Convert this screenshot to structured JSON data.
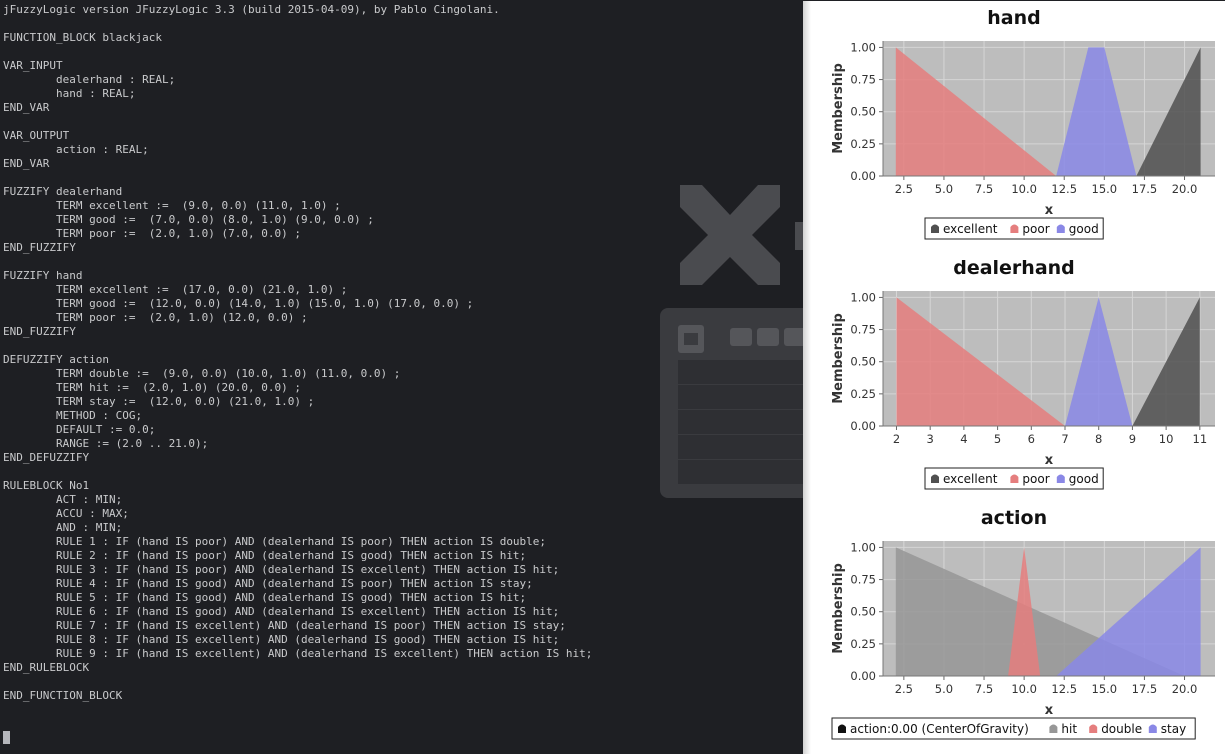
{
  "terminal": {
    "lines": [
      "jFuzzyLogic version JFuzzyLogic 3.3 (build 2015-04-09), by Pablo Cingolani.",
      "",
      "FUNCTION_BLOCK blackjack",
      "",
      "VAR_INPUT",
      "\tdealerhand : REAL;",
      "\thand : REAL;",
      "END_VAR",
      "",
      "VAR_OUTPUT",
      "\taction : REAL;",
      "END_VAR",
      "",
      "FUZZIFY dealerhand",
      "\tTERM excellent :=  (9.0, 0.0) (11.0, 1.0) ;",
      "\tTERM good :=  (7.0, 0.0) (8.0, 1.0) (9.0, 0.0) ;",
      "\tTERM poor :=  (2.0, 1.0) (7.0, 0.0) ;",
      "END_FUZZIFY",
      "",
      "FUZZIFY hand",
      "\tTERM excellent :=  (17.0, 0.0) (21.0, 1.0) ;",
      "\tTERM good :=  (12.0, 0.0) (14.0, 1.0) (15.0, 1.0) (17.0, 0.0) ;",
      "\tTERM poor :=  (2.0, 1.0) (12.0, 0.0) ;",
      "END_FUZZIFY",
      "",
      "DEFUZZIFY action",
      "\tTERM double :=  (9.0, 0.0) (10.0, 1.0) (11.0, 0.0) ;",
      "\tTERM hit :=  (2.0, 1.0) (20.0, 0.0) ;",
      "\tTERM stay :=  (12.0, 0.0) (21.0, 1.0) ;",
      "\tMETHOD : COG;",
      "\tDEFAULT := 0.0;",
      "\tRANGE := (2.0 .. 21.0);",
      "END_DEFUZZIFY",
      "",
      "RULEBLOCK No1",
      "\tACT : MIN;",
      "\tACCU : MAX;",
      "\tAND : MIN;",
      "\tRULE 1 : IF (hand IS poor) AND (dealerhand IS poor) THEN action IS double;",
      "\tRULE 2 : IF (hand IS poor) AND (dealerhand IS good) THEN action IS hit;",
      "\tRULE 3 : IF (hand IS poor) AND (dealerhand IS excellent) THEN action IS hit;",
      "\tRULE 4 : IF (hand IS good) AND (dealerhand IS poor) THEN action IS stay;",
      "\tRULE 5 : IF (hand IS good) AND (dealerhand IS good) THEN action IS hit;",
      "\tRULE 6 : IF (hand IS good) AND (dealerhand IS excellent) THEN action IS hit;",
      "\tRULE 7 : IF (hand IS excellent) AND (dealerhand IS poor) THEN action IS stay;",
      "\tRULE 8 : IF (hand IS excellent) AND (dealerhand IS good) THEN action IS hit;",
      "\tRULE 9 : IF (hand IS excellent) AND (dealerhand IS excellent) THEN action IS hit;",
      "END_RULEBLOCK",
      "",
      "END_FUNCTION_BLOCK"
    ],
    "bg_color": "#1e1f23",
    "text_color": "#c9cacc"
  },
  "wallpaper": {
    "logo_icon": "x-keyboard-logo-icon"
  },
  "colors": {
    "plot_bg": "#bdbdbd",
    "grid": "#d6d6d6",
    "excellent": "#505050",
    "poor": "#e57e7e",
    "good": "#8a88e6",
    "hit": "#979797",
    "double": "#e57e7e",
    "stay": "#8a88e6"
  },
  "chart_data": [
    {
      "type": "area",
      "title": "hand",
      "xlabel": "x",
      "ylabel": "Membership",
      "xlim": [
        1.2,
        21.9
      ],
      "ylim": [
        0,
        1.05
      ],
      "xticks": [
        "2.5",
        "5.0",
        "7.5",
        "10.0",
        "12.5",
        "15.0",
        "17.5",
        "20.0"
      ],
      "xtick_values": [
        2.5,
        5.0,
        7.5,
        10.0,
        12.5,
        15.0,
        17.5,
        20.0
      ],
      "yticks": [
        "0.00",
        "0.25",
        "0.50",
        "0.75",
        "1.00"
      ],
      "ytick_values": [
        0,
        0.25,
        0.5,
        0.75,
        1.0
      ],
      "grid": true,
      "legend_position": "bottom",
      "series": [
        {
          "name": "excellent",
          "color_key": "excellent",
          "points": [
            [
              17.0,
              0.0
            ],
            [
              21.0,
              1.0
            ],
            [
              21.0,
              0.0
            ]
          ]
        },
        {
          "name": "poor",
          "color_key": "poor",
          "points": [
            [
              2.0,
              0.0
            ],
            [
              2.0,
              1.0
            ],
            [
              12.0,
              0.0
            ]
          ]
        },
        {
          "name": "good",
          "color_key": "good",
          "points": [
            [
              12.0,
              0.0
            ],
            [
              14.0,
              1.0
            ],
            [
              15.0,
              1.0
            ],
            [
              17.0,
              0.0
            ]
          ]
        }
      ],
      "legend": [
        "excellent",
        "poor",
        "good"
      ]
    },
    {
      "type": "area",
      "title": "dealerhand",
      "xlabel": "x",
      "ylabel": "Membership",
      "xlim": [
        1.6,
        11.45
      ],
      "ylim": [
        0,
        1.05
      ],
      "xticks": [
        "2",
        "3",
        "4",
        "5",
        "6",
        "7",
        "8",
        "9",
        "10",
        "11"
      ],
      "xtick_values": [
        2,
        3,
        4,
        5,
        6,
        7,
        8,
        9,
        10,
        11
      ],
      "yticks": [
        "0.00",
        "0.25",
        "0.50",
        "0.75",
        "1.00"
      ],
      "ytick_values": [
        0,
        0.25,
        0.5,
        0.75,
        1.0
      ],
      "grid": true,
      "legend_position": "bottom",
      "series": [
        {
          "name": "excellent",
          "color_key": "excellent",
          "points": [
            [
              9.0,
              0.0
            ],
            [
              11.0,
              1.0
            ],
            [
              11.0,
              0.0
            ]
          ]
        },
        {
          "name": "poor",
          "color_key": "poor",
          "points": [
            [
              2.0,
              0.0
            ],
            [
              2.0,
              1.0
            ],
            [
              7.0,
              0.0
            ]
          ]
        },
        {
          "name": "good",
          "color_key": "good",
          "points": [
            [
              7.0,
              0.0
            ],
            [
              8.0,
              1.0
            ],
            [
              9.0,
              0.0
            ]
          ]
        }
      ],
      "legend": [
        "excellent",
        "poor",
        "good"
      ]
    },
    {
      "type": "area",
      "title": "action",
      "xlabel": "x",
      "ylabel": "Membership",
      "xlim": [
        1.2,
        21.9
      ],
      "ylim": [
        0,
        1.05
      ],
      "xticks": [
        "2.5",
        "5.0",
        "7.5",
        "10.0",
        "12.5",
        "15.0",
        "17.5",
        "20.0"
      ],
      "xtick_values": [
        2.5,
        5.0,
        7.5,
        10.0,
        12.5,
        15.0,
        17.5,
        20.0
      ],
      "yticks": [
        "0.00",
        "0.25",
        "0.50",
        "0.75",
        "1.00"
      ],
      "ytick_values": [
        0,
        0.25,
        0.5,
        0.75,
        1.0
      ],
      "grid": true,
      "legend_position": "bottom",
      "series": [
        {
          "name": "hit",
          "color_key": "hit",
          "points": [
            [
              2.0,
              0.0
            ],
            [
              2.0,
              1.0
            ],
            [
              20.0,
              0.0
            ]
          ]
        },
        {
          "name": "double",
          "color_key": "double",
          "points": [
            [
              9.0,
              0.0
            ],
            [
              10.0,
              1.0
            ],
            [
              11.0,
              0.0
            ]
          ]
        },
        {
          "name": "stay",
          "color_key": "stay",
          "points": [
            [
              12.0,
              0.0
            ],
            [
              21.0,
              1.0
            ],
            [
              21.0,
              0.0
            ]
          ]
        }
      ],
      "legend": [
        "action:0.00 (CenterOfGravity)",
        "hit",
        "double",
        "stay"
      ],
      "legend_first_color": "#111111"
    }
  ]
}
